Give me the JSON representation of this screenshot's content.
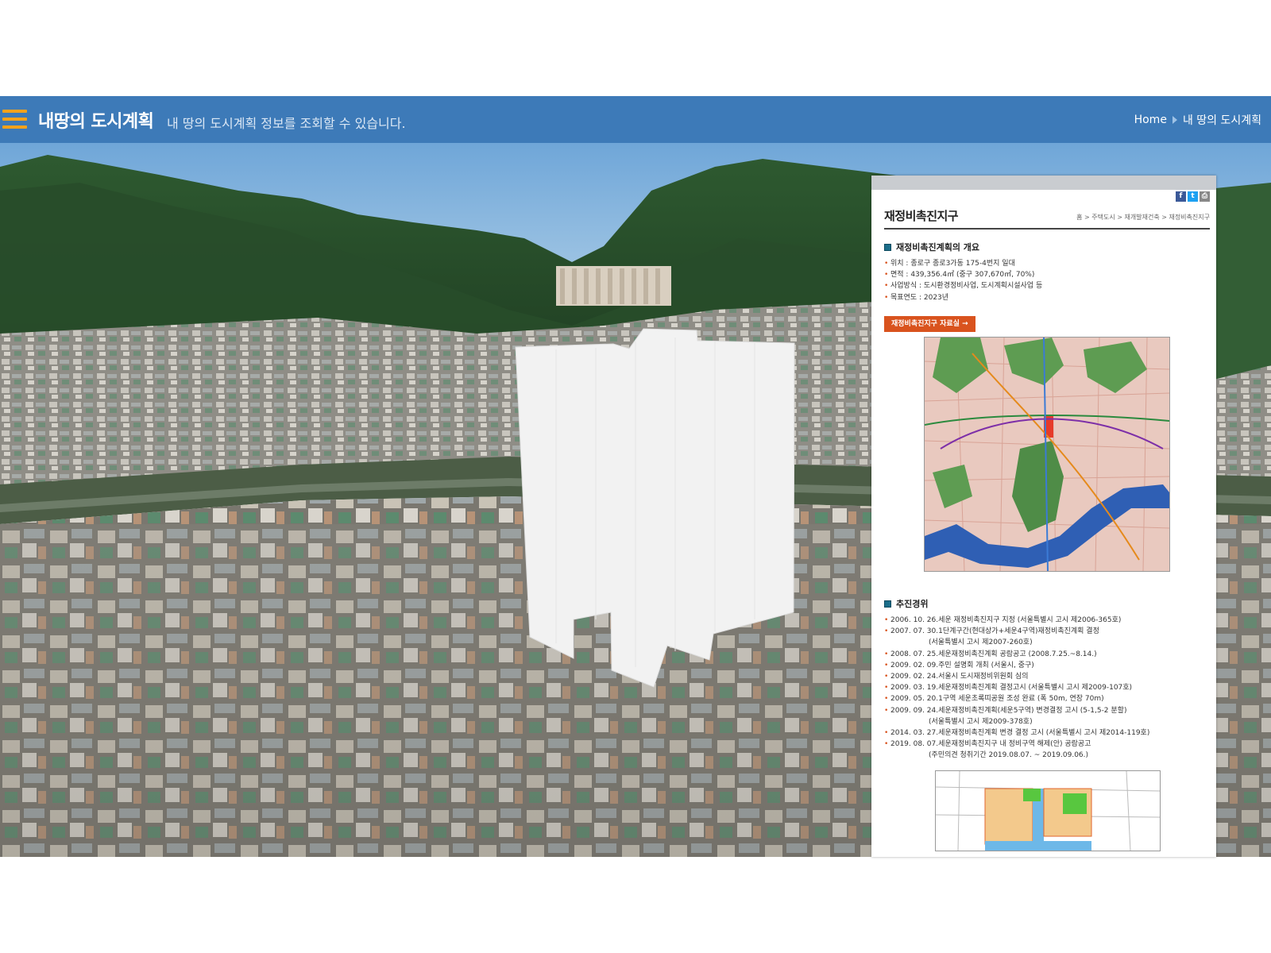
{
  "header": {
    "title": "내땅의 도시계획",
    "subtitle": "내 땅의 도시계획 정보를 조회할 수 있습니다.",
    "breadcrumb": [
      "Home",
      "내 땅의 도시계획"
    ]
  },
  "panel": {
    "title": "재정비촉진지구",
    "path": "홈 > 주택도시 > 재개발재건축 > 재정비촉진지구",
    "share": {
      "facebook": "f",
      "twitter": "t",
      "print": "⎙"
    },
    "overview": {
      "heading": "재정비촉진계획의 개요",
      "items": [
        "위치 : 종로구 종로3가동 175-4번지 일대",
        "면적 : 439,356.4㎡ (중구 307,670㎡, 70%)",
        "사업방식 : 도시환경정비사업, 도시계획시설사업 등",
        "목표연도 : 2023년"
      ]
    },
    "button_label": "재정비촉진지구 자료실 →",
    "history": {
      "heading": "추진경위",
      "items": [
        "2006. 10. 26.세운 재정비촉진지구 지정 (서울특별시 고시 제2006-365호)",
        "2007. 07. 30.1단계구간(현대상가+세운4구역)재정비촉진계획 결정",
        "(서울특별시 고시 제2007-260호)",
        "2008. 07. 25.세운재정비촉진계획 공람공고 (2008.7.25.~8.14.)",
        "2009. 02. 09.주민 설명회 개최 (서울시, 중구)",
        "2009. 02. 24.서울시 도시재정비위원회 심의",
        "2009. 03. 19.세운재정비촉진계획 결정고시 (서울특별시 고시 제2009-107호)",
        "2009. 05. 20.1구역 세운초록띠공원 조성 완료 (폭 50m, 연장 70m)",
        "2009. 09. 24.세운재정비촉진계획(세운5구역) 변경결정 고시 (5-1,5-2 분할)",
        "(서울특별시 고시 제2009-378호)",
        "2014. 03. 27.세운재정비촉진계획 변경 결정 고시 (서울특별시 고시 제2014-119호)",
        "2019. 08. 07.세운재정비촉진지구 내 정비구역 해제(안) 공람공고",
        "(주민의견 청취기간 2019.08.07. ~ 2019.09.06.)"
      ]
    }
  },
  "colors": {
    "header_bg": "#3d7ab8",
    "menu_icon": "#f3a21c",
    "accent_button": "#d9531e",
    "section_marker": "#1b6e8a"
  }
}
